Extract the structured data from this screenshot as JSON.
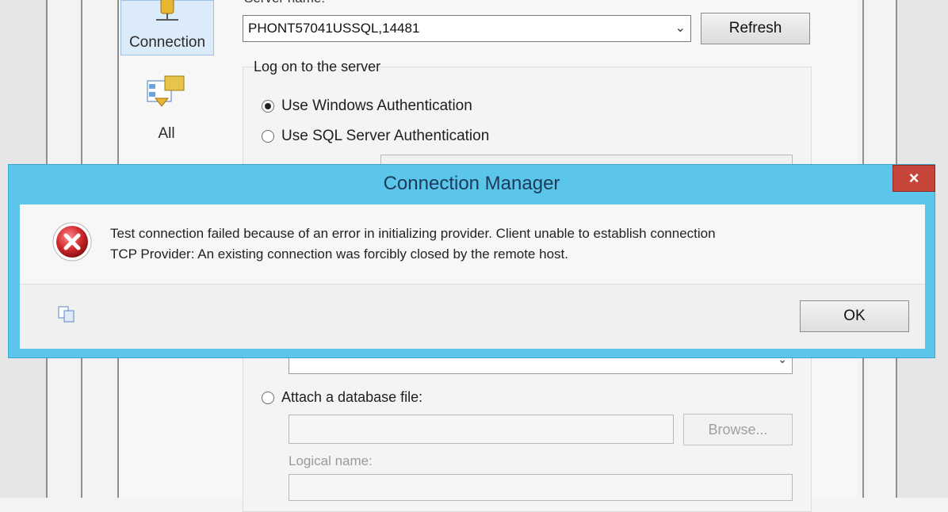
{
  "background_window": {
    "nav": [
      {
        "label": "Connection",
        "icon": "database-server-icon",
        "selected": true
      },
      {
        "label": "All",
        "icon": "properties-grid-icon",
        "selected": false
      }
    ],
    "server_name_label": "Server name:",
    "server_name_value": "PHONT57041USSQL,14481",
    "refresh_label": "Refresh",
    "logon_group_label": "Log on to the server",
    "auth_options": [
      {
        "label": "Use Windows Authentication",
        "selected": true
      },
      {
        "label": "Use SQL Server Authentication",
        "selected": false
      }
    ],
    "attach_db_label": "Attach a database file:",
    "browse_label": "Browse...",
    "logical_name_label": "Logical name:"
  },
  "dialog": {
    "title": "Connection Manager",
    "close_glyph": "×",
    "icon": "error-icon",
    "message_lines": [
      "Test connection failed because of an error in initializing provider. Client unable to establish connection",
      "TCP Provider: An existing connection was forcibly closed by the remote host."
    ],
    "ok_label": "OK",
    "copy_icon": "copy-icon"
  },
  "colors": {
    "dialog_frame": "#5bc5ea",
    "close_button": "#c7443a",
    "error_red": "#c8282e",
    "nav_selected": "#dcebf9"
  }
}
